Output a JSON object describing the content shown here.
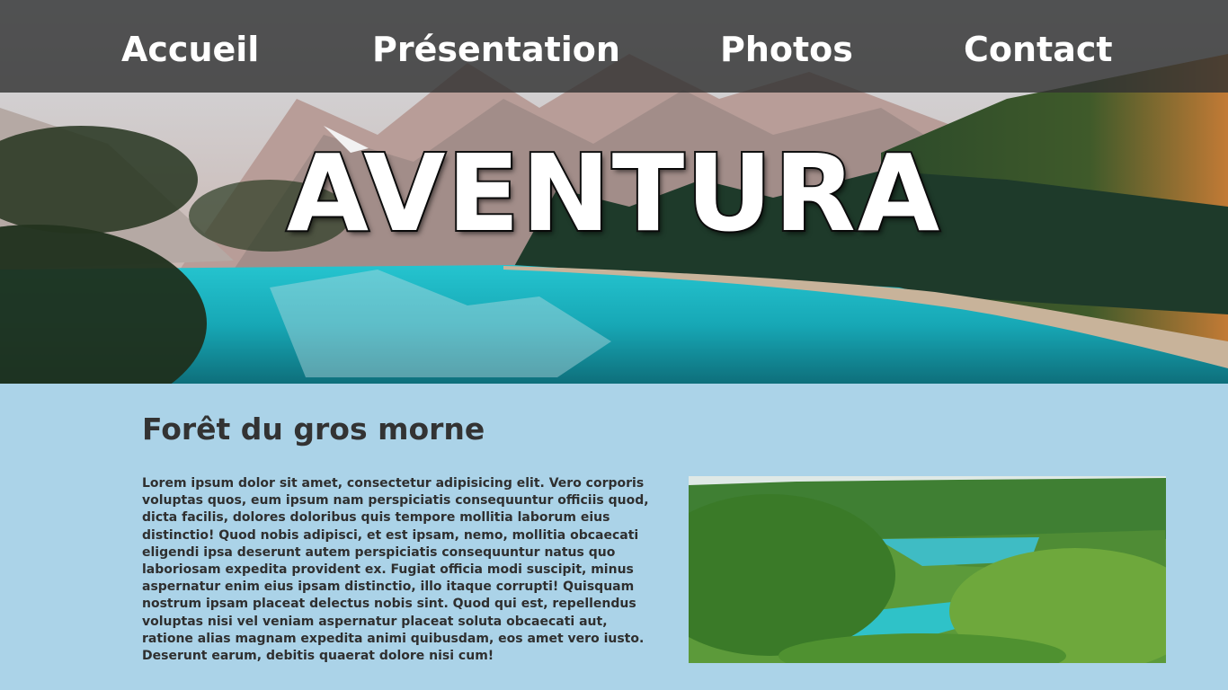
{
  "nav": {
    "items": [
      {
        "label": "Accueil"
      },
      {
        "label": "Présentation"
      },
      {
        "label": "Photos"
      },
      {
        "label": "Contact"
      }
    ]
  },
  "hero": {
    "title": "AVENTURA",
    "image_alt": "mountain-lake-forest"
  },
  "main": {
    "title": "Forêt du gros morne",
    "paragraph": "Lorem ipsum dolor sit amet, consectetur adipisicing elit. Vero corporis voluptas quos, eum ipsum nam perspiciatis consequuntur officiis quod, dicta facilis, dolores doloribus quis tempore mollitia laborum eius distinctio! Quod nobis adipisci, et est ipsam, nemo, mollitia obcaecati eligendi ipsa deserunt autem perspiciatis consequuntur natus quo laboriosam expedita provident ex. Fugiat officia modi suscipit, minus aspernatur enim eius ipsam distinctio, illo itaque corrupti! Quisquam nostrum ipsam placeat delectus nobis sint. Quod qui est, repellendus voluptas nisi vel veniam aspernatur placeat soluta obcaecati aut, ratione alias magnam expedita animi quibusdam, eos amet vero iusto. Deserunt earum, debitis quaerat dolore nisi cum!",
    "image_alt": "green-forest-turquoise-lake"
  },
  "colors": {
    "page_bg": "#abd3e8",
    "nav_bg": "#323232",
    "water": "#1fb5c2"
  }
}
